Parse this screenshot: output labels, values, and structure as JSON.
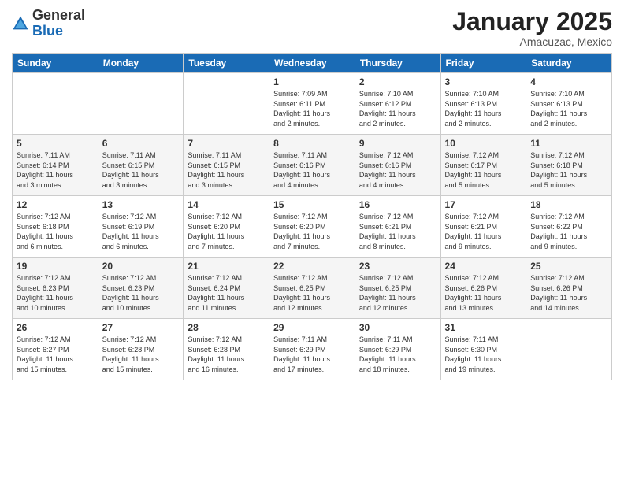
{
  "logo": {
    "general": "General",
    "blue": "Blue"
  },
  "title": "January 2025",
  "subtitle": "Amacuzac, Mexico",
  "days_header": [
    "Sunday",
    "Monday",
    "Tuesday",
    "Wednesday",
    "Thursday",
    "Friday",
    "Saturday"
  ],
  "weeks": [
    [
      {
        "day": "",
        "content": ""
      },
      {
        "day": "",
        "content": ""
      },
      {
        "day": "",
        "content": ""
      },
      {
        "day": "1",
        "content": "Sunrise: 7:09 AM\nSunset: 6:11 PM\nDaylight: 11 hours\nand 2 minutes."
      },
      {
        "day": "2",
        "content": "Sunrise: 7:10 AM\nSunset: 6:12 PM\nDaylight: 11 hours\nand 2 minutes."
      },
      {
        "day": "3",
        "content": "Sunrise: 7:10 AM\nSunset: 6:13 PM\nDaylight: 11 hours\nand 2 minutes."
      },
      {
        "day": "4",
        "content": "Sunrise: 7:10 AM\nSunset: 6:13 PM\nDaylight: 11 hours\nand 2 minutes."
      }
    ],
    [
      {
        "day": "5",
        "content": "Sunrise: 7:11 AM\nSunset: 6:14 PM\nDaylight: 11 hours\nand 3 minutes."
      },
      {
        "day": "6",
        "content": "Sunrise: 7:11 AM\nSunset: 6:15 PM\nDaylight: 11 hours\nand 3 minutes."
      },
      {
        "day": "7",
        "content": "Sunrise: 7:11 AM\nSunset: 6:15 PM\nDaylight: 11 hours\nand 3 minutes."
      },
      {
        "day": "8",
        "content": "Sunrise: 7:11 AM\nSunset: 6:16 PM\nDaylight: 11 hours\nand 4 minutes."
      },
      {
        "day": "9",
        "content": "Sunrise: 7:12 AM\nSunset: 6:16 PM\nDaylight: 11 hours\nand 4 minutes."
      },
      {
        "day": "10",
        "content": "Sunrise: 7:12 AM\nSunset: 6:17 PM\nDaylight: 11 hours\nand 5 minutes."
      },
      {
        "day": "11",
        "content": "Sunrise: 7:12 AM\nSunset: 6:18 PM\nDaylight: 11 hours\nand 5 minutes."
      }
    ],
    [
      {
        "day": "12",
        "content": "Sunrise: 7:12 AM\nSunset: 6:18 PM\nDaylight: 11 hours\nand 6 minutes."
      },
      {
        "day": "13",
        "content": "Sunrise: 7:12 AM\nSunset: 6:19 PM\nDaylight: 11 hours\nand 6 minutes."
      },
      {
        "day": "14",
        "content": "Sunrise: 7:12 AM\nSunset: 6:20 PM\nDaylight: 11 hours\nand 7 minutes."
      },
      {
        "day": "15",
        "content": "Sunrise: 7:12 AM\nSunset: 6:20 PM\nDaylight: 11 hours\nand 7 minutes."
      },
      {
        "day": "16",
        "content": "Sunrise: 7:12 AM\nSunset: 6:21 PM\nDaylight: 11 hours\nand 8 minutes."
      },
      {
        "day": "17",
        "content": "Sunrise: 7:12 AM\nSunset: 6:21 PM\nDaylight: 11 hours\nand 9 minutes."
      },
      {
        "day": "18",
        "content": "Sunrise: 7:12 AM\nSunset: 6:22 PM\nDaylight: 11 hours\nand 9 minutes."
      }
    ],
    [
      {
        "day": "19",
        "content": "Sunrise: 7:12 AM\nSunset: 6:23 PM\nDaylight: 11 hours\nand 10 minutes."
      },
      {
        "day": "20",
        "content": "Sunrise: 7:12 AM\nSunset: 6:23 PM\nDaylight: 11 hours\nand 10 minutes."
      },
      {
        "day": "21",
        "content": "Sunrise: 7:12 AM\nSunset: 6:24 PM\nDaylight: 11 hours\nand 11 minutes."
      },
      {
        "day": "22",
        "content": "Sunrise: 7:12 AM\nSunset: 6:25 PM\nDaylight: 11 hours\nand 12 minutes."
      },
      {
        "day": "23",
        "content": "Sunrise: 7:12 AM\nSunset: 6:25 PM\nDaylight: 11 hours\nand 12 minutes."
      },
      {
        "day": "24",
        "content": "Sunrise: 7:12 AM\nSunset: 6:26 PM\nDaylight: 11 hours\nand 13 minutes."
      },
      {
        "day": "25",
        "content": "Sunrise: 7:12 AM\nSunset: 6:26 PM\nDaylight: 11 hours\nand 14 minutes."
      }
    ],
    [
      {
        "day": "26",
        "content": "Sunrise: 7:12 AM\nSunset: 6:27 PM\nDaylight: 11 hours\nand 15 minutes."
      },
      {
        "day": "27",
        "content": "Sunrise: 7:12 AM\nSunset: 6:28 PM\nDaylight: 11 hours\nand 15 minutes."
      },
      {
        "day": "28",
        "content": "Sunrise: 7:12 AM\nSunset: 6:28 PM\nDaylight: 11 hours\nand 16 minutes."
      },
      {
        "day": "29",
        "content": "Sunrise: 7:11 AM\nSunset: 6:29 PM\nDaylight: 11 hours\nand 17 minutes."
      },
      {
        "day": "30",
        "content": "Sunrise: 7:11 AM\nSunset: 6:29 PM\nDaylight: 11 hours\nand 18 minutes."
      },
      {
        "day": "31",
        "content": "Sunrise: 7:11 AM\nSunset: 6:30 PM\nDaylight: 11 hours\nand 19 minutes."
      },
      {
        "day": "",
        "content": ""
      }
    ]
  ]
}
